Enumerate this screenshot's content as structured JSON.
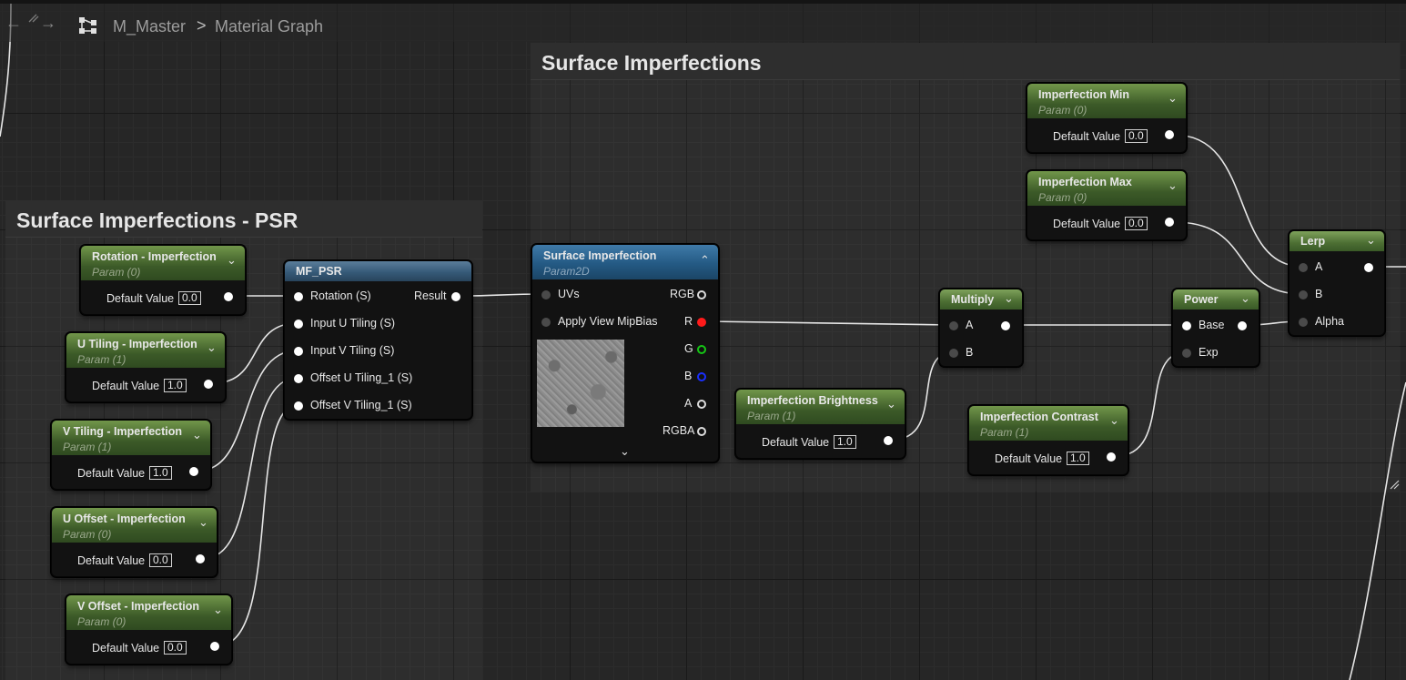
{
  "breadcrumb": {
    "root": "M_Master",
    "separator": ">",
    "page": "Material Graph"
  },
  "comments": [
    {
      "title": "Surface Imperfections"
    },
    {
      "title": "Surface Imperfections - PSR"
    }
  ],
  "param_nodes": [
    {
      "title": "Rotation - Imperfection",
      "subtitle": "Param (0)",
      "field_label": "Default Value",
      "value": "0.0"
    },
    {
      "title": "U Tiling - Imperfection",
      "subtitle": "Param (1)",
      "field_label": "Default Value",
      "value": "1.0"
    },
    {
      "title": "V Tiling - Imperfection",
      "subtitle": "Param (1)",
      "field_label": "Default Value",
      "value": "1.0"
    },
    {
      "title": "U Offset - Imperfection",
      "subtitle": "Param (0)",
      "field_label": "Default Value",
      "value": "0.0"
    },
    {
      "title": "V Offset - Imperfection",
      "subtitle": "Param (0)",
      "field_label": "Default Value",
      "value": "0.0"
    },
    {
      "title": "Imperfection Brightness",
      "subtitle": "Param (1)",
      "field_label": "Default Value",
      "value": "1.0"
    },
    {
      "title": "Imperfection Contrast",
      "subtitle": "Param (1)",
      "field_label": "Default Value",
      "value": "1.0"
    },
    {
      "title": "Imperfection Min",
      "subtitle": "Param (0)",
      "field_label": "Default Value",
      "value": "0.0"
    },
    {
      "title": "Imperfection Max",
      "subtitle": "Param (0)",
      "field_label": "Default Value",
      "value": "0.0"
    }
  ],
  "mf_psr": {
    "title": "MF_PSR",
    "inputs": [
      "Rotation (S)",
      "Input U Tiling (S)",
      "Input V Tiling (S)",
      "Offset U Tiling_1 (S)",
      "Offset V Tiling_1 (S)"
    ],
    "output": "Result"
  },
  "texture_node": {
    "title": "Surface Imperfection",
    "subtitle": "Param2D",
    "inputs": [
      "UVs",
      "Apply View MipBias"
    ],
    "outputs": [
      "RGB",
      "R",
      "G",
      "B",
      "A",
      "RGBA"
    ]
  },
  "multiply": {
    "title": "Multiply",
    "inputs": [
      "A",
      "B"
    ]
  },
  "power": {
    "title": "Power",
    "inputs": [
      "Base",
      "Exp"
    ]
  },
  "lerp": {
    "title": "Lerp",
    "inputs": [
      "A",
      "B",
      "Alpha"
    ]
  },
  "colors": {
    "param_header": "#4c6e33",
    "texture_header": "#245a84",
    "function_header": "#365a78",
    "wire": "#e8e8e8"
  }
}
